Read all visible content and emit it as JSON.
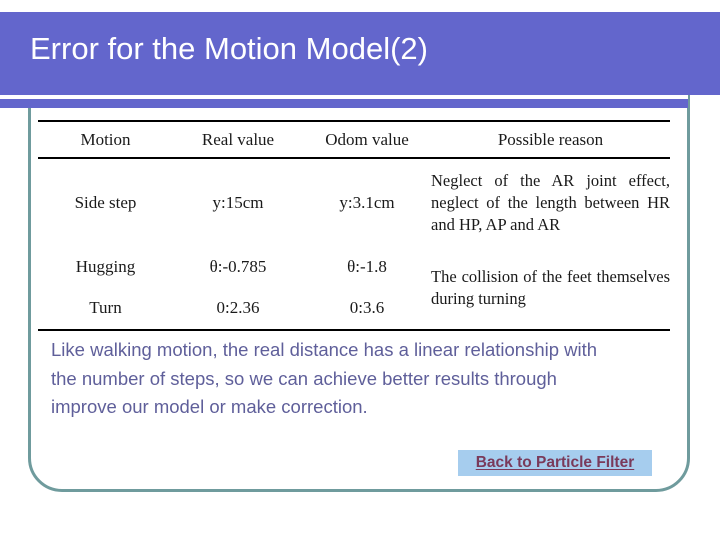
{
  "slide": {
    "title": "Error for the Motion Model(2)",
    "banner_color": "#6366CC",
    "frame_color": "#6F9B9D",
    "body_text_color": "#5F5F9A"
  },
  "table": {
    "headers": [
      "Motion",
      "Real value",
      "Odom value",
      "Possible reason"
    ],
    "rows": [
      {
        "motion": "Side step",
        "real_value": "y:15cm",
        "odom_value": "y:3.1cm",
        "reason": "Neglect of the AR joint effect, neglect of the length between HR and HP, AP and AR"
      },
      {
        "motion": "Hugging",
        "real_value": "θ:-0.785",
        "odom_value": "θ:-1.8",
        "reason": "The collision of the feet themselves during turning"
      },
      {
        "motion": "Turn",
        "real_value": "0:2.36",
        "odom_value": "0:3.6",
        "reason": ""
      }
    ]
  },
  "body": {
    "paragraph": "Like walking motion, the real distance has a linear relationship with the number of steps, so we can achieve better results through improve our model or make correction."
  },
  "link": {
    "label": "Back to Particle Filter",
    "highlight_color": "#A6CDEE",
    "text_color": "#7A3A5A"
  }
}
